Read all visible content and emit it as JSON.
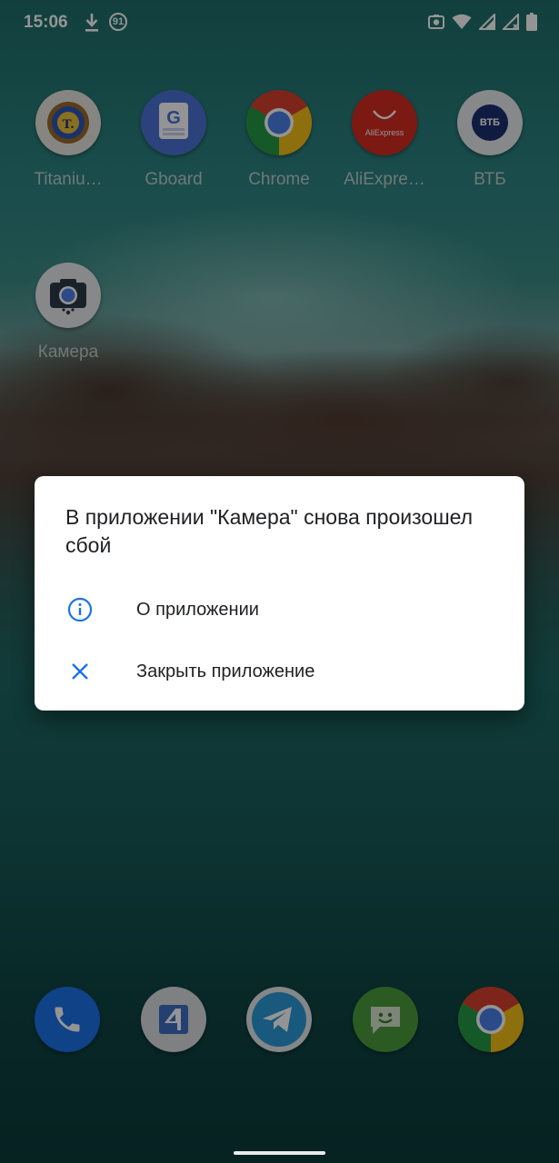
{
  "status_bar": {
    "time": "15:06",
    "notification_count": "91"
  },
  "home_apps": [
    {
      "label": "Titaniu…",
      "icon": "titanium-backup-icon"
    },
    {
      "label": "Gboard",
      "icon": "gboard-icon"
    },
    {
      "label": "Chrome",
      "icon": "chrome-icon"
    },
    {
      "label": "AliExpre…",
      "icon": "aliexpress-icon",
      "icon_text": "AliExpress"
    },
    {
      "label": "ВТБ",
      "icon": "vtb-icon",
      "icon_text": "ВТБ"
    },
    {
      "label": "Камера",
      "icon": "camera-icon"
    }
  ],
  "dock": [
    {
      "icon": "phone-icon"
    },
    {
      "icon": "app-4-icon"
    },
    {
      "icon": "telegram-icon"
    },
    {
      "icon": "messenger-icon"
    },
    {
      "icon": "chrome-icon"
    }
  ],
  "dialog": {
    "title": "В приложении \"Камера\" снова произошел сбой",
    "items": [
      {
        "label": "О приложении",
        "icon": "info-icon"
      },
      {
        "label": "Закрыть приложение",
        "icon": "close-icon"
      }
    ]
  },
  "colors": {
    "accent": "#1a73e8",
    "dialog_text": "#202124"
  }
}
